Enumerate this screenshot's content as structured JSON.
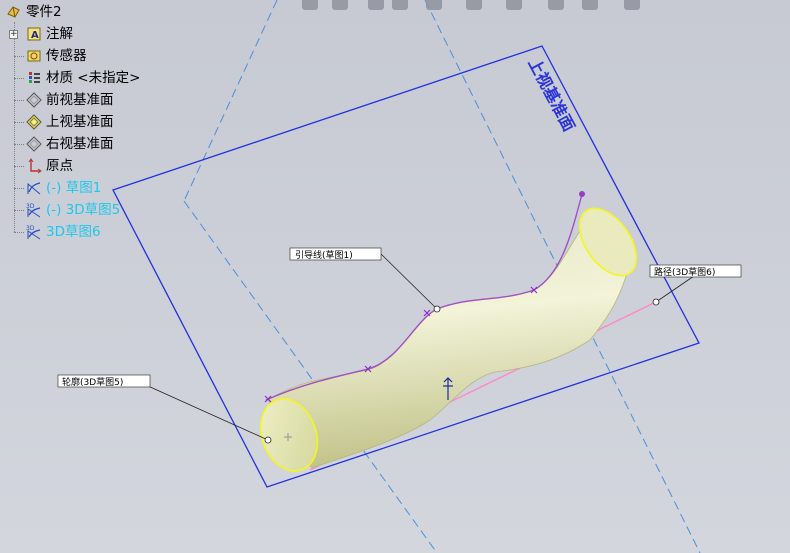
{
  "feature_tree": {
    "root": {
      "label": "零件2",
      "icon": "part-icon"
    },
    "items": [
      {
        "label": "注解",
        "icon": "annotations-icon",
        "expandable": true
      },
      {
        "label": "传感器",
        "icon": "sensors-icon"
      },
      {
        "label": "材质 <未指定>",
        "icon": "material-icon"
      },
      {
        "label": "前视基准面",
        "icon": "plane-icon"
      },
      {
        "label": "上视基准面",
        "icon": "plane-selected-icon"
      },
      {
        "label": "右视基准面",
        "icon": "plane-icon"
      },
      {
        "label": "原点",
        "icon": "origin-icon"
      },
      {
        "label": "(-) 草图1",
        "icon": "sketch-icon"
      },
      {
        "label": "(-) 3D草图5",
        "icon": "3d-sketch-icon"
      },
      {
        "label": "3D草图6",
        "icon": "3d-sketch-icon"
      }
    ]
  },
  "graphics": {
    "plane_label": "上视基准面",
    "callouts": {
      "guide": "引导线(草图1)",
      "path": "路径(3D草图6)",
      "profile": "轮廓(3D草图5)"
    }
  },
  "colors": {
    "plane_edge": "#2030e0",
    "dashed_line": "#4a8fdc",
    "guide_curve": "#a050c0",
    "path_line": "#ff88c8",
    "profile_edge": "#f5f520",
    "sketch_text": "#1ec8ea"
  }
}
